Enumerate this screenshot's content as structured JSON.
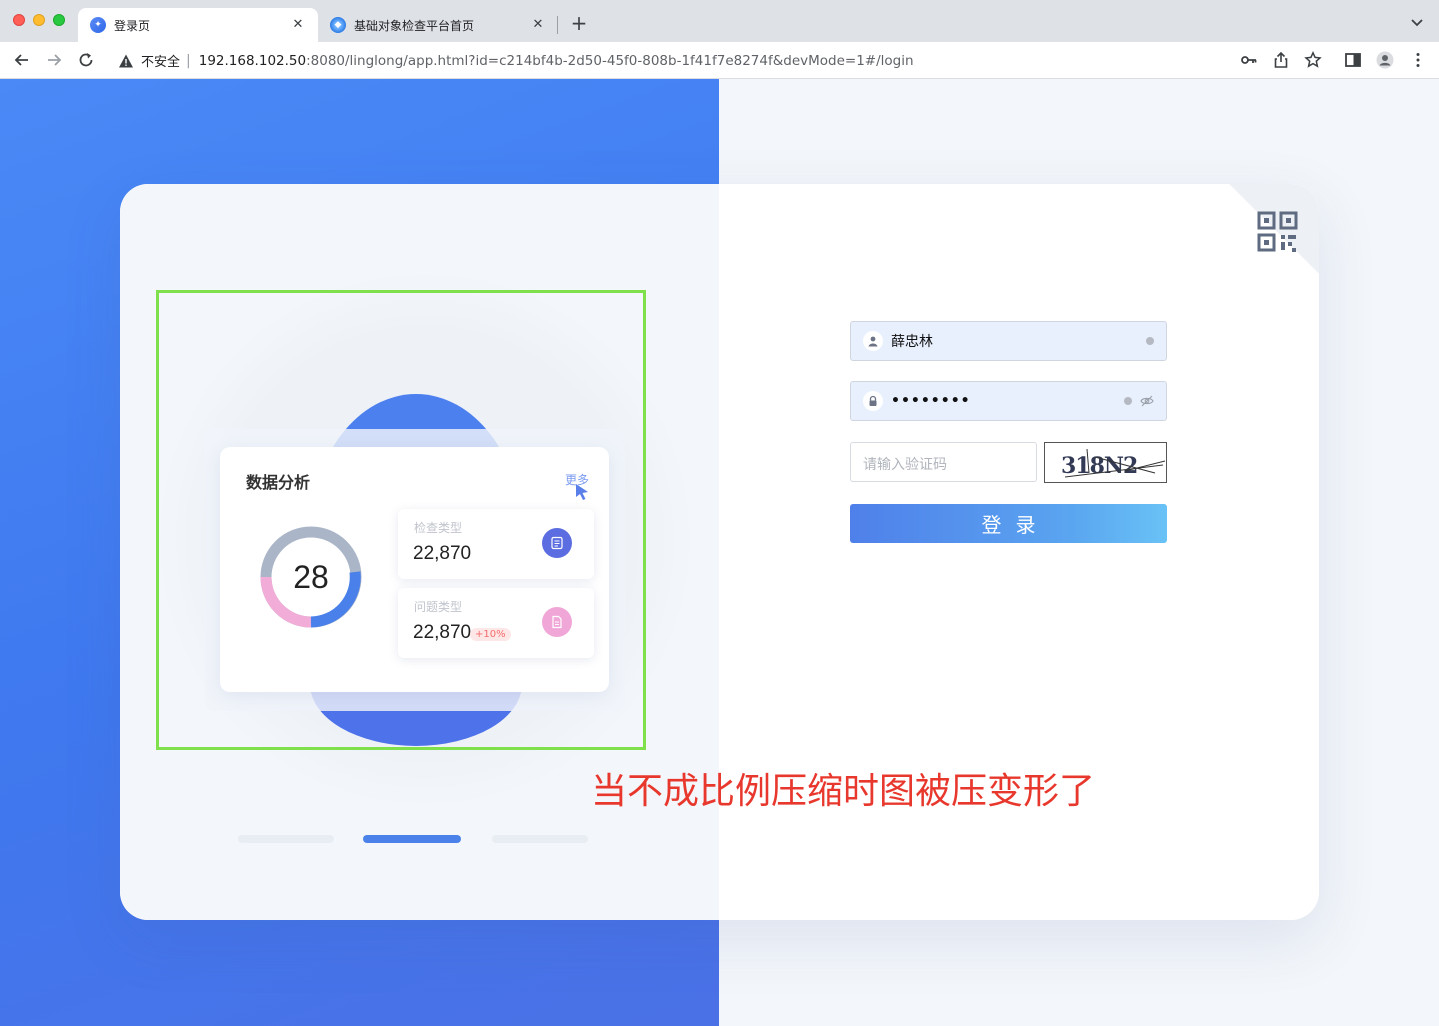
{
  "browser": {
    "tabs": [
      {
        "title": "登录页",
        "active": true
      },
      {
        "title": "基础对象检查平台首页",
        "active": false
      }
    ],
    "new_tab_label": "+",
    "url": {
      "security_label": "不安全",
      "host": "192.168.102.50",
      "path": ":8080/linglong/app.html?id=c214bf4b-2d50-45f0-808b-1f41f7e8274f&devMode=1#/login"
    }
  },
  "illustration": {
    "panel_title": "数据分析",
    "more_label": "更多",
    "donut_value": "28",
    "stats": [
      {
        "label": "检查类型",
        "value": "22,870",
        "badge": ""
      },
      {
        "label": "问题类型",
        "value": "22,870",
        "badge": "+10%"
      }
    ]
  },
  "login": {
    "username_value": "薛忠林",
    "password_mask": "••••••••",
    "captcha_placeholder": "请输入验证码",
    "captcha_text": "318N2",
    "submit_label": "登录"
  },
  "annotation": "当不成比例压缩时图被压变形了",
  "colors": {
    "brand_blue": "#4a89f6",
    "highlight_green": "#7ee04a",
    "annotation_red": "#e8382d"
  }
}
